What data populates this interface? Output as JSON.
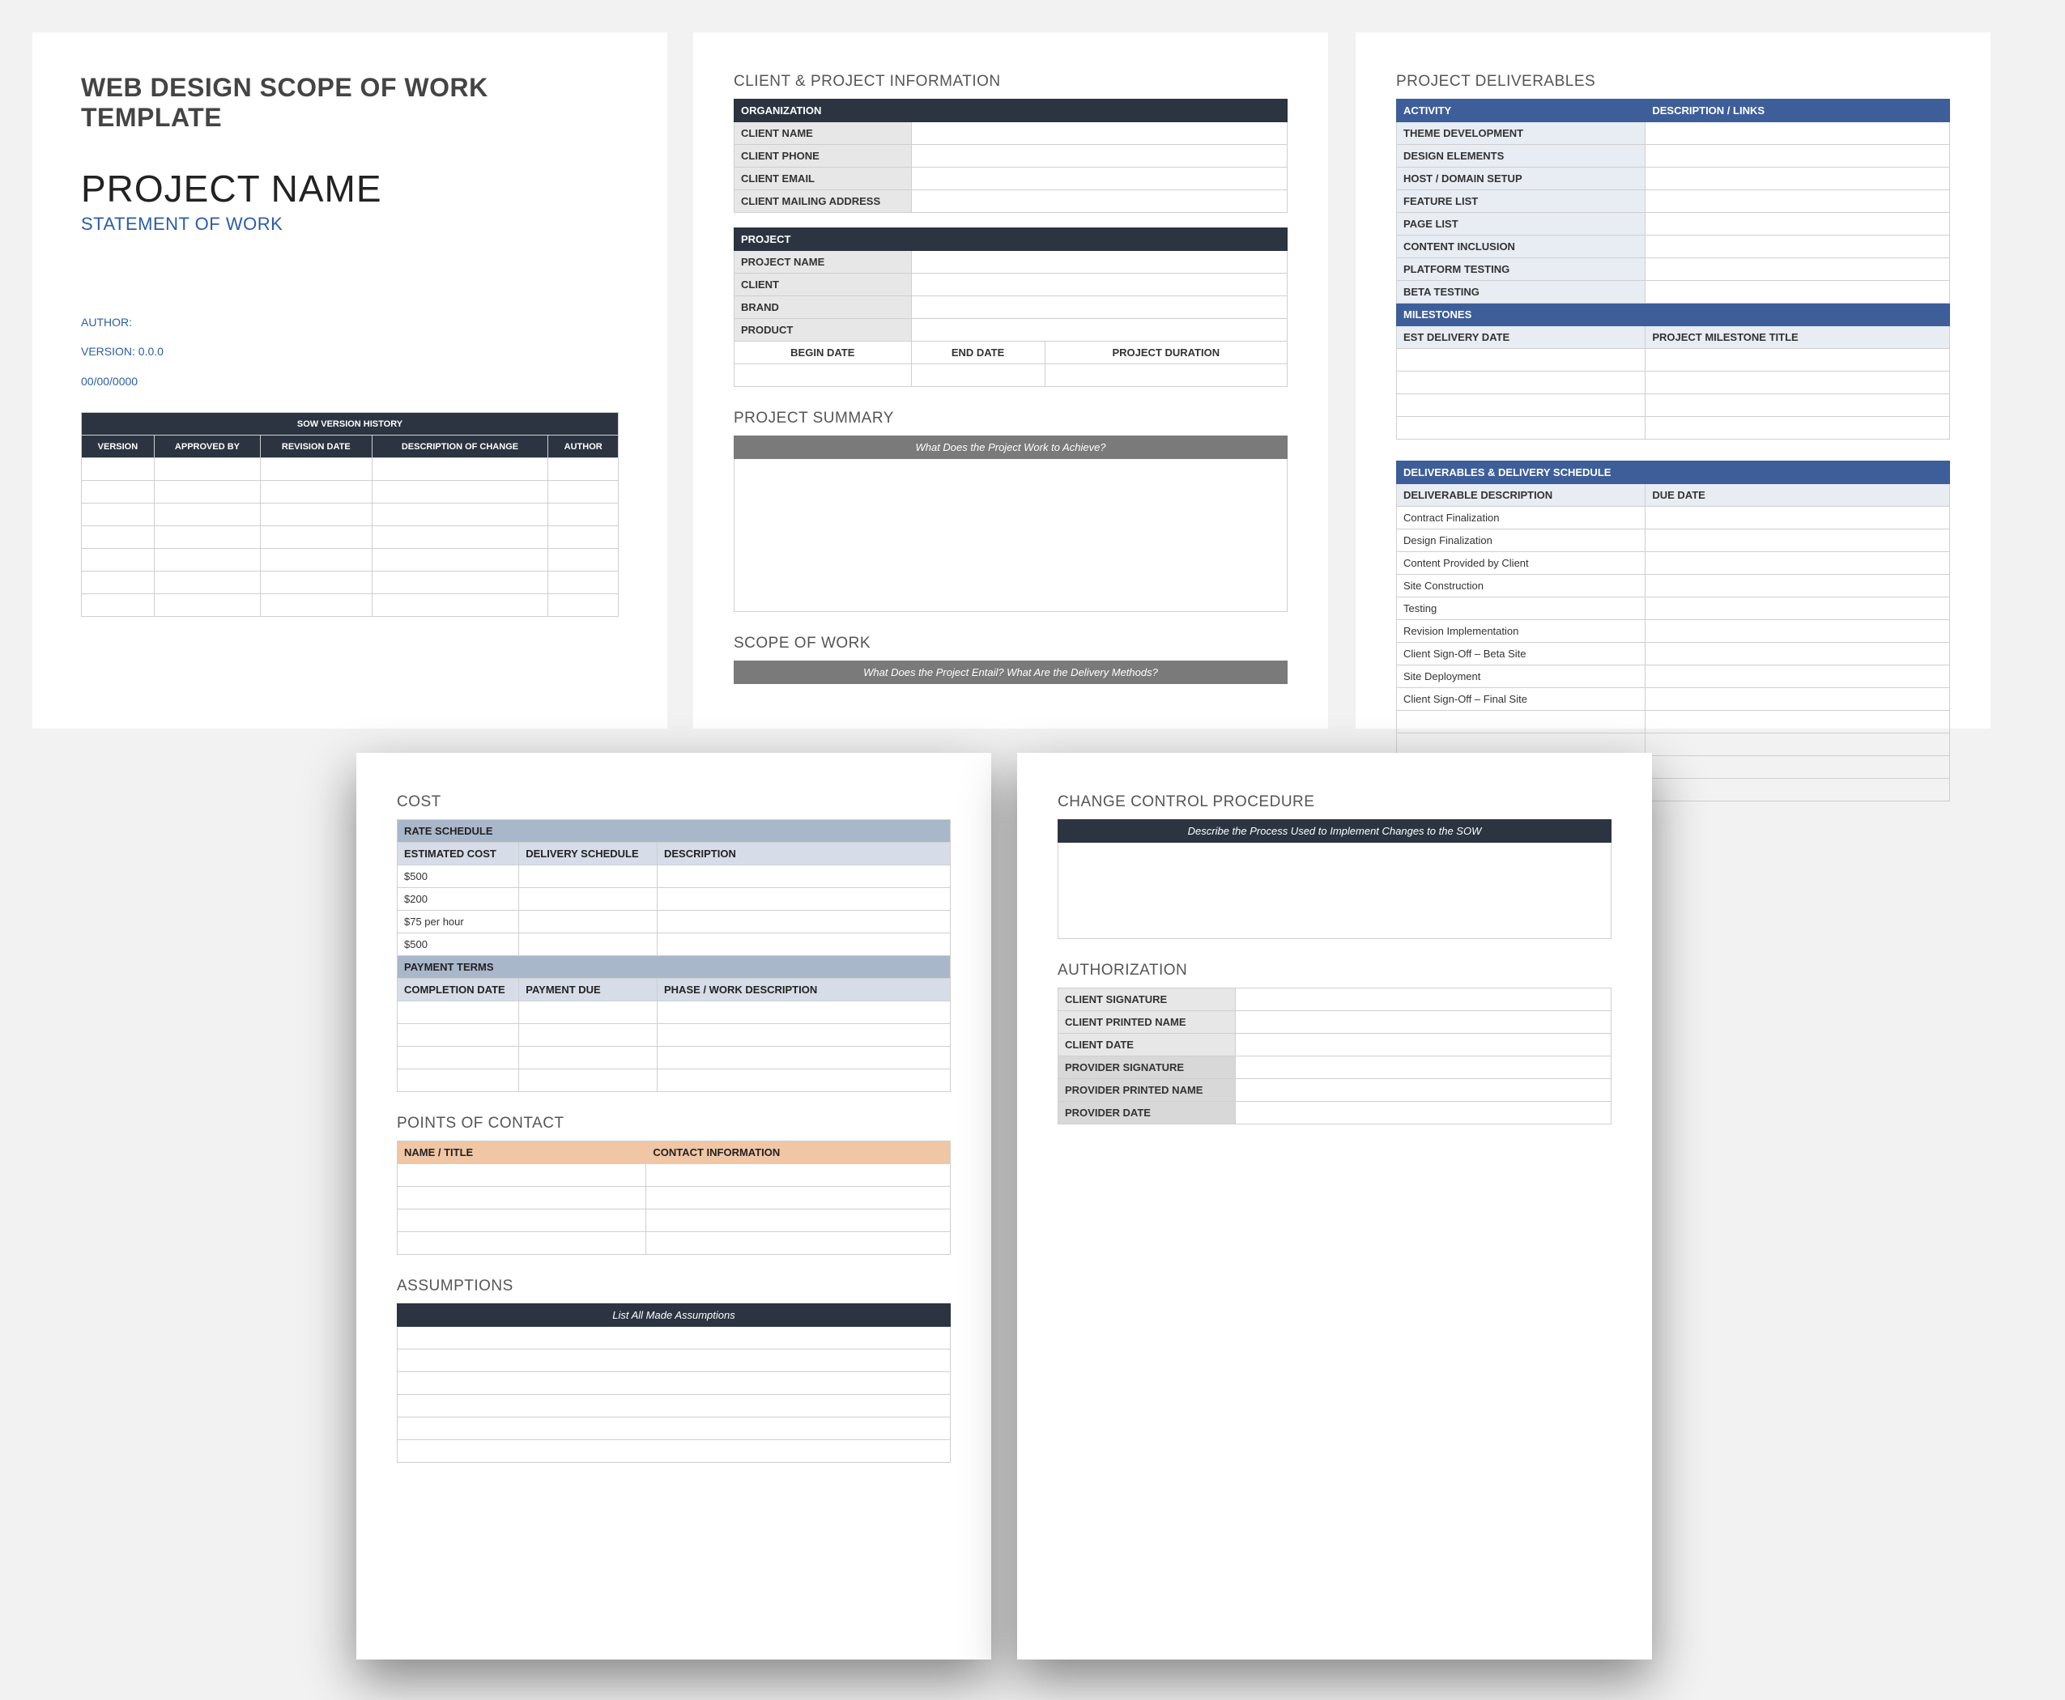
{
  "page1": {
    "title": "WEB DESIGN SCOPE OF WORK TEMPLATE",
    "project": "PROJECT NAME",
    "sow": "STATEMENT OF WORK",
    "author_lbl": "AUTHOR:",
    "version_lbl": "VERSION: 0.0.0",
    "date": "00/00/0000",
    "hist_title": "SOW VERSION HISTORY",
    "hist_cols": [
      "VERSION",
      "APPROVED BY",
      "REVISION DATE",
      "DESCRIPTION OF CHANGE",
      "AUTHOR"
    ]
  },
  "page2": {
    "client_title": "CLIENT & PROJECT INFORMATION",
    "org_header": "ORGANIZATION",
    "org_rows": [
      "CLIENT NAME",
      "CLIENT  PHONE",
      "CLIENT EMAIL",
      "CLIENT MAILING ADDRESS"
    ],
    "proj_header": "PROJECT",
    "proj_rows": [
      "PROJECT NAME",
      "CLIENT",
      "BRAND",
      "PRODUCT"
    ],
    "proj_cols": [
      "BEGIN DATE",
      "END DATE",
      "PROJECT DURATION"
    ],
    "summary_title": "PROJECT SUMMARY",
    "summary_prompt": "What Does the Project Work to Achieve?",
    "scope_title": "SCOPE OF WORK",
    "scope_prompt": "What Does the Project Entail? What Are the Delivery Methods?"
  },
  "page3": {
    "deliv_title": "PROJECT DELIVERABLES",
    "cols": [
      "ACTIVITY",
      "DESCRIPTION / LINKS"
    ],
    "activities": [
      "THEME DEVELOPMENT",
      "DESIGN ELEMENTS",
      "HOST / DOMAIN SETUP",
      "FEATURE LIST",
      "PAGE LIST",
      "CONTENT INCLUSION",
      "PLATFORM TESTING",
      "BETA TESTING"
    ],
    "ms_header": "MILESTONES",
    "ms_cols": [
      "EST DELIVERY DATE",
      "PROJECT MILESTONE TITLE"
    ],
    "sched_header": "DELIVERABLES & DELIVERY SCHEDULE",
    "sched_cols": [
      "DELIVERABLE DESCRIPTION",
      "DUE DATE"
    ],
    "sched_rows": [
      "Contract Finalization",
      "Design Finalization",
      "Content Provided by Client",
      "Site Construction",
      "Testing",
      "Revision Implementation",
      "Client Sign-Off – Beta Site",
      "Site Deployment",
      "Client Sign-Off – Final Site"
    ]
  },
  "page4": {
    "cost_title": "COST",
    "rate_header": "RATE SCHEDULE",
    "rate_cols": [
      "ESTIMATED COST",
      "DELIVERY SCHEDULE",
      "DESCRIPTION"
    ],
    "rate_rows": [
      "$500",
      "$200",
      "$75 per hour",
      "$500"
    ],
    "pay_header": "PAYMENT TERMS",
    "pay_cols": [
      "COMPLETION DATE",
      "PAYMENT DUE",
      "PHASE / WORK DESCRIPTION"
    ],
    "poc_title": "POINTS OF CONTACT",
    "poc_cols": [
      "NAME / TITLE",
      "CONTACT INFORMATION"
    ],
    "assump_title": "ASSUMPTIONS",
    "assump_prompt": "List All Made Assumptions"
  },
  "page5": {
    "ccp_title": "CHANGE CONTROL PROCEDURE",
    "ccp_prompt": "Describe the Process Used to Implement Changes to the SOW",
    "auth_title": "AUTHORIZATION",
    "auth_rows_a": [
      "CLIENT SIGNATURE",
      "CLIENT PRINTED NAME",
      "CLIENT DATE"
    ],
    "auth_rows_b": [
      "PROVIDER SIGNATURE",
      "PROVIDER PRINTED NAME",
      "PROVIDER DATE"
    ]
  }
}
